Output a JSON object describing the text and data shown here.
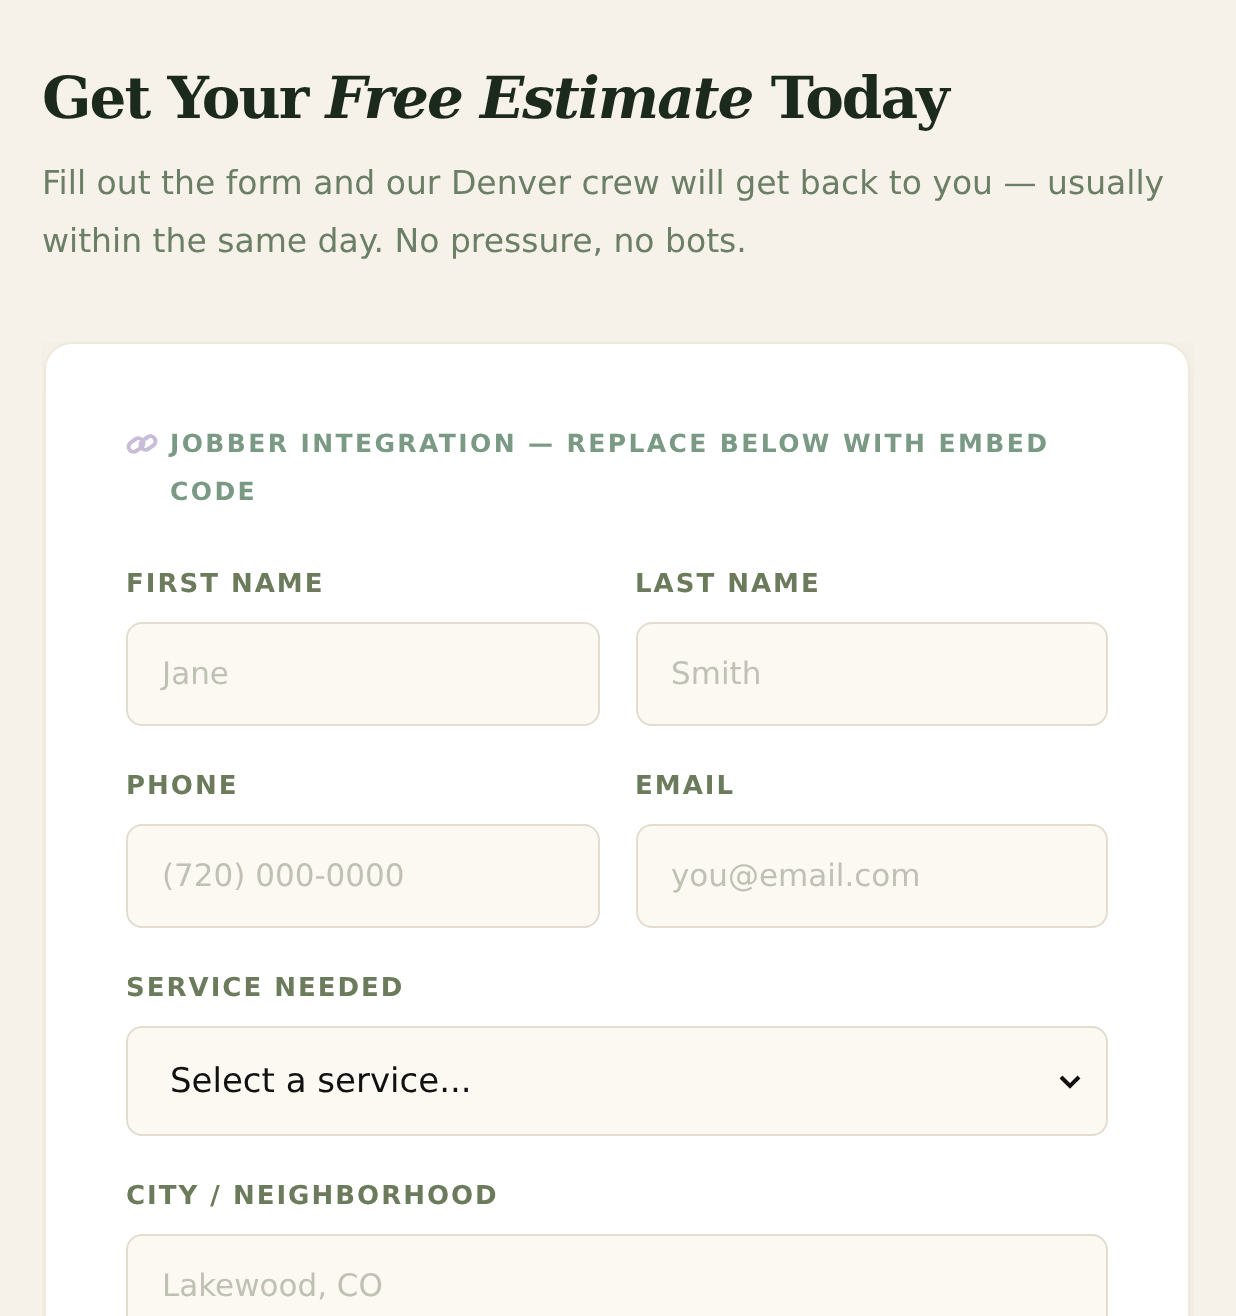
{
  "heading": "Get Your *Free Estimate* Today",
  "intro": "Fill out the form and our Denver crew will get back to you — usually within the same day. No pressure, no bots.",
  "form": {
    "notice": "JOBBER INTEGRATION — REPLACE BELOW WITH EMBED CODE",
    "fields": [
      {
        "kind": "text",
        "label": "FIRST NAME",
        "placeholder": "Jane",
        "half": true
      },
      {
        "kind": "text",
        "label": "LAST NAME",
        "placeholder": "Smith",
        "half": true
      },
      {
        "kind": "text",
        "label": "PHONE",
        "placeholder": "(720) 000-0000",
        "half": true
      },
      {
        "kind": "text",
        "label": "EMAIL",
        "placeholder": "you@email.com",
        "half": true
      },
      {
        "kind": "select",
        "label": "SERVICE NEEDED",
        "value": "Select a service...",
        "half": false
      },
      {
        "kind": "text",
        "label": "CITY / NEIGHBORHOOD",
        "placeholder": "Lakewood, CO",
        "half": false
      }
    ]
  }
}
